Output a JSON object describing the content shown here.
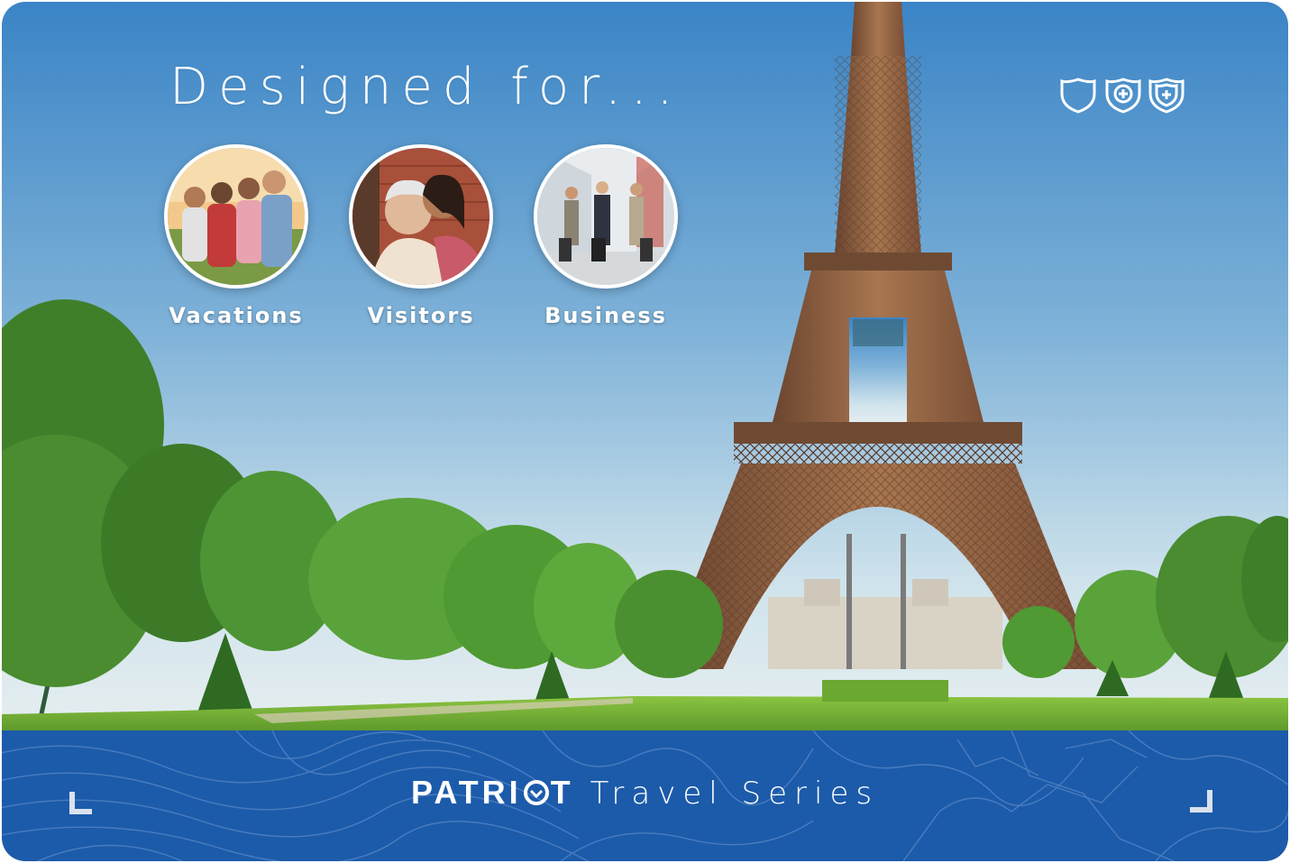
{
  "hero": {
    "headline": "Designed for...",
    "scene_icon": "eiffel-tower-park-photo"
  },
  "badges": {
    "icons": [
      "shield-outline-icon",
      "shield-cross-icon",
      "shield-cross-double-icon"
    ]
  },
  "categories": [
    {
      "label": "Vacations",
      "photo_icon": "group-of-friends-photo"
    },
    {
      "label": "Visitors",
      "photo_icon": "grandmother-granddaughter-photo"
    },
    {
      "label": "Business",
      "photo_icon": "business-travelers-photo"
    }
  ],
  "footer": {
    "brand_left": "PATRI",
    "brand_right": "T",
    "brand_o_icon": "patriot-shield-o-icon",
    "series": "Travel Series",
    "background_pattern": "topographic-lines"
  },
  "colors": {
    "sky_top": "#3a84c6",
    "sky_bottom": "#cfe3ec",
    "footer_blue": "#1c5baa",
    "grass": "#7bb93a",
    "tower": "#8a5a3c",
    "text": "#ffffff"
  }
}
